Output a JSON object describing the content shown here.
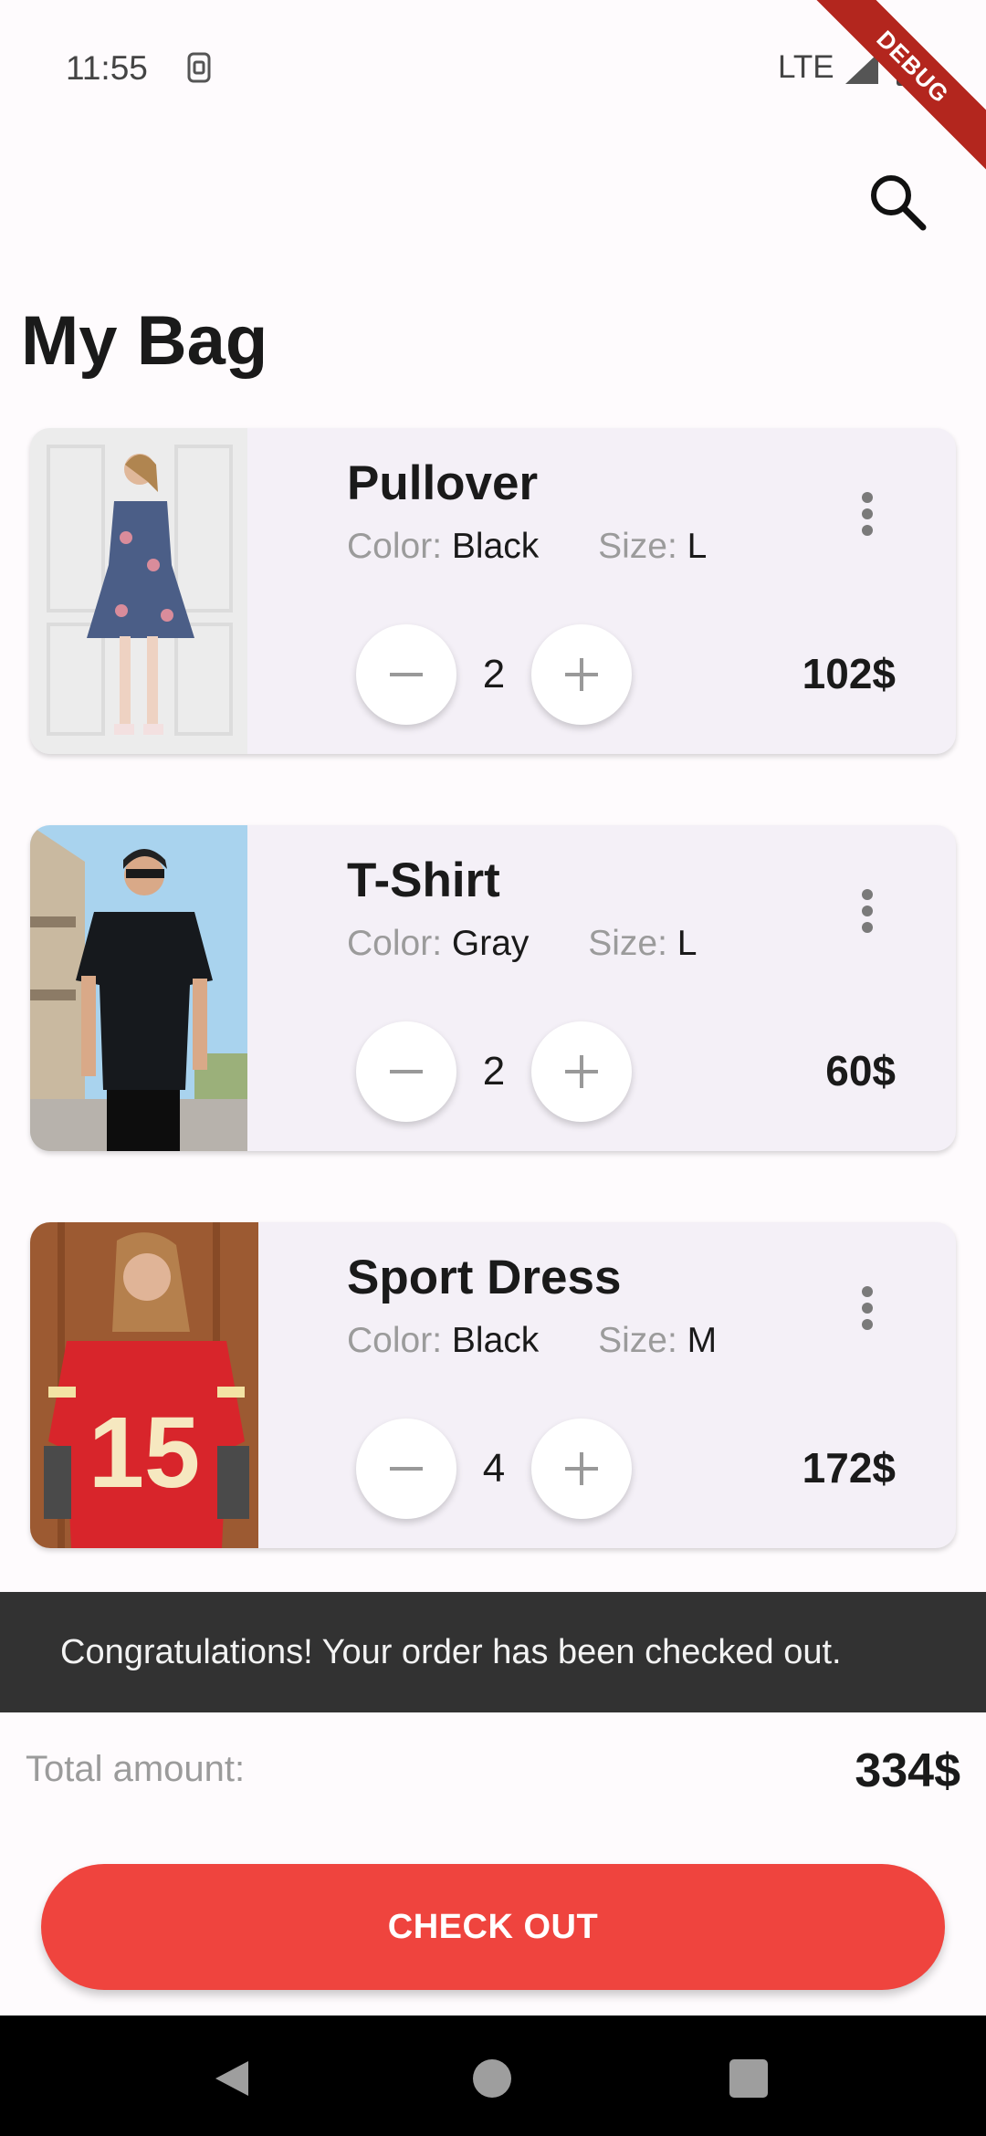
{
  "status_bar": {
    "time": "11:55",
    "network": "LTE"
  },
  "debug_banner": "DEBUG",
  "page": {
    "title": "My Bag"
  },
  "items": [
    {
      "name": "Pullover",
      "color_label": "Color:",
      "color": "Black",
      "size_label": "Size:",
      "size": "L",
      "quantity": "2",
      "price": "102$"
    },
    {
      "name": "T-Shirt",
      "color_label": "Color:",
      "color": "Gray",
      "size_label": "Size:",
      "size": "L",
      "quantity": "2",
      "price": "60$"
    },
    {
      "name": "Sport Dress",
      "color_label": "Color:",
      "color": "Black",
      "size_label": "Size:",
      "size": "M",
      "quantity": "4",
      "price": "172$"
    }
  ],
  "snackbar": {
    "message": "Congratulations! Your order has been checked out."
  },
  "summary": {
    "total_label": "Total amount:",
    "total_value": "334$",
    "checkout_label": "CHECK OUT"
  },
  "icons": {
    "search": "search-icon",
    "more": "more-vert-icon",
    "minus": "minus-icon",
    "plus": "plus-icon",
    "back": "back-icon",
    "home": "home-icon",
    "recent": "recents-icon"
  },
  "colors": {
    "accent": "#ef443e",
    "card": "#f4f0f7",
    "snackbar": "#323232",
    "background": "#fefbfd"
  }
}
